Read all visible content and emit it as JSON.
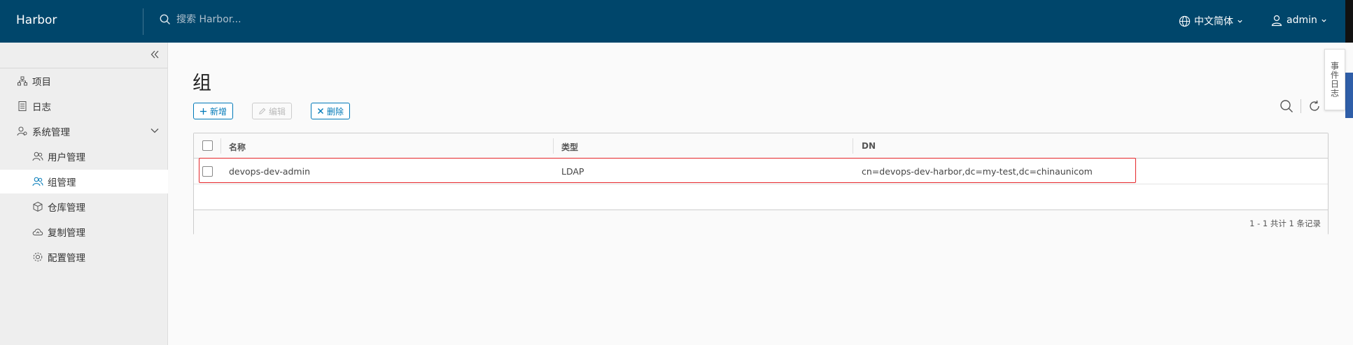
{
  "header": {
    "brand": "Harbor",
    "search_placeholder": "搜索 Harbor...",
    "language": "中文简体",
    "user": "admin"
  },
  "sidebar": {
    "items": [
      {
        "label": "项目",
        "icon": "project-icon"
      },
      {
        "label": "日志",
        "icon": "log-icon"
      },
      {
        "label": "系统管理",
        "icon": "system-admin-icon"
      },
      {
        "label": "用户管理",
        "icon": "users-icon"
      },
      {
        "label": "组管理",
        "icon": "groups-icon"
      },
      {
        "label": "仓库管理",
        "icon": "registry-icon"
      },
      {
        "label": "复制管理",
        "icon": "replication-icon"
      },
      {
        "label": "配置管理",
        "icon": "config-icon"
      }
    ],
    "active": "组管理"
  },
  "page": {
    "title": "组",
    "buttons": {
      "add": "新增",
      "edit": "编辑",
      "delete": "删除"
    }
  },
  "table": {
    "columns": [
      "名称",
      "类型",
      "DN"
    ],
    "rows": [
      {
        "name": "devops-dev-admin",
        "type": "LDAP",
        "dn": "cn=devops-dev-harbor,dc=my-test,dc=chinaunicom"
      }
    ],
    "footer": "1 - 1 共计 1 条记录"
  },
  "side_tab": "事件日志",
  "colors": {
    "header_bg": "#00466b",
    "accent": "#0079b8",
    "highlight": "#e5262a"
  }
}
